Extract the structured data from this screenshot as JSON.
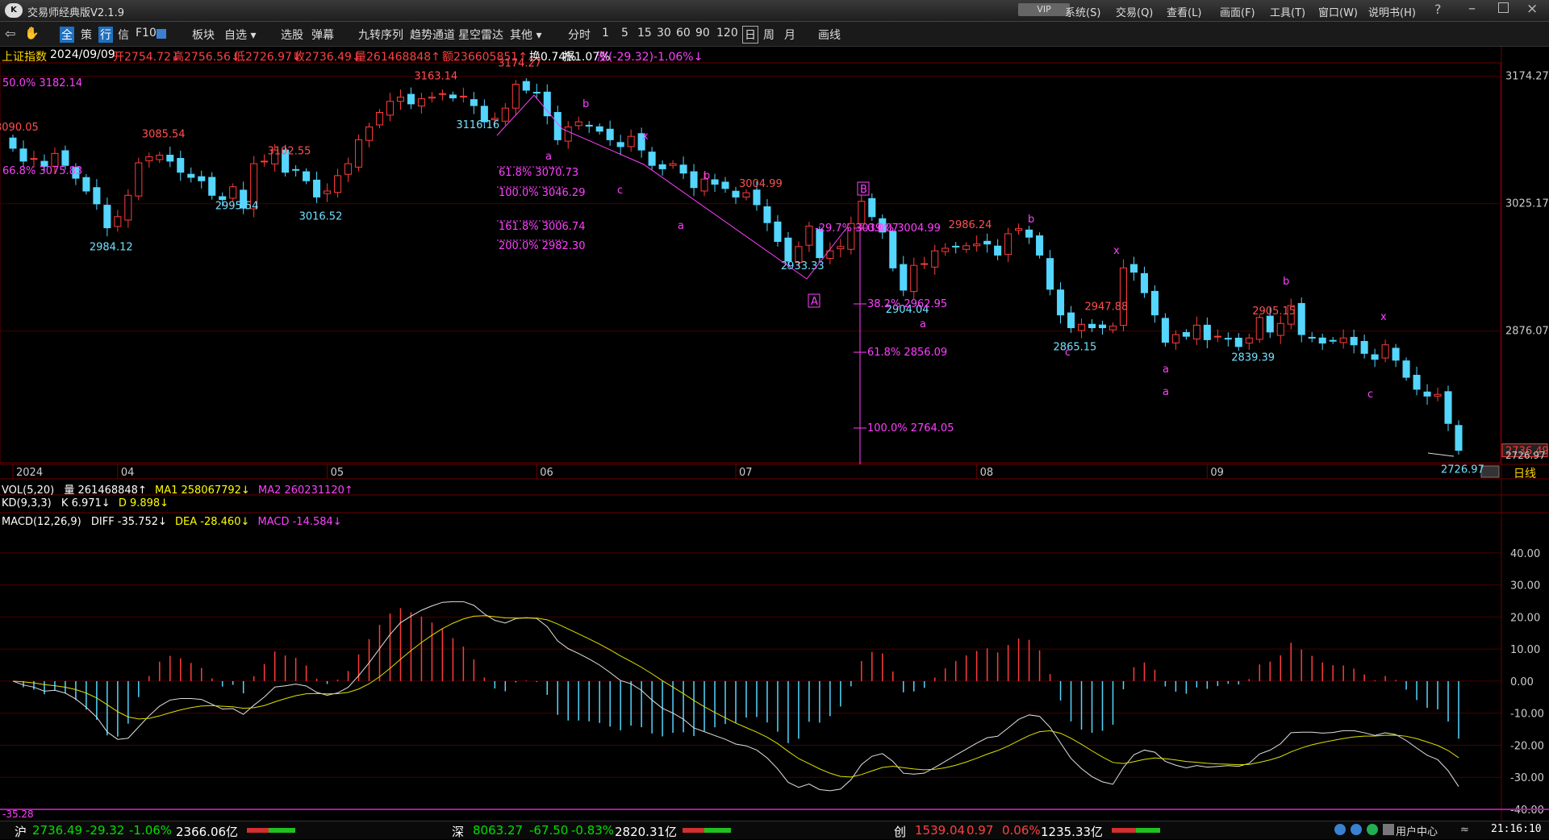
{
  "app": {
    "title": "交易师经典版V2.1.9",
    "vip": "VIP"
  },
  "menu": [
    "系统(S)",
    "交易(Q)",
    "查看(L)",
    "画面(F)",
    "工具(T)",
    "窗口(W)",
    "说明书(H)"
  ],
  "toolbar": {
    "nav_items": [
      "全",
      "策",
      "行",
      "信",
      "F10"
    ],
    "items": [
      "板块",
      "自选",
      "选股",
      "弹幕",
      "九转序列",
      "趋势通道",
      "星空雷达",
      "其他"
    ],
    "periods": [
      "分时",
      "1",
      "5",
      "15",
      "30",
      "60",
      "90",
      "120",
      "日",
      "周",
      "月"
    ],
    "draw_label": "画线"
  },
  "quote": {
    "name": "上证指数",
    "date": "2024/09/09",
    "open": "开2754.72↓",
    "high": "高2756.56↓",
    "low": "低2726.97↓",
    "close": "收2736.49↓",
    "volume": "量261468848↑",
    "amount": "额236605851↑",
    "turnover": "换0.74%",
    "amplitude": "振1.07%",
    "change": "涨(-29.32)-1.06%↓"
  },
  "colors": {
    "up": "#ff3b3b",
    "down": "#54d6ff",
    "mark": "#ff40ff",
    "dif": "#e0e0e0",
    "dea": "#e0e000"
  },
  "chart_data": [
    {
      "type": "candlestick",
      "title": "上证指数",
      "x_labels": [
        {
          "i": 0,
          "label": "2024"
        },
        {
          "i": 10,
          "label": "04"
        },
        {
          "i": 30,
          "label": "05"
        },
        {
          "i": 50,
          "label": "06"
        },
        {
          "i": 69,
          "label": "07"
        },
        {
          "i": 92,
          "label": "08"
        },
        {
          "i": 114,
          "label": "09"
        }
      ],
      "ylim": [
        2722,
        3190
      ],
      "y_ticks": [
        "3174.27",
        "3025.17",
        "2876.07"
      ],
      "last_price": "2736.49",
      "low_axis_label": "2726.97",
      "period_label": "日线",
      "fib_top": "50.0% 3182.14",
      "fib_left": "66.8% 3075.83",
      "closes": [
        3090.05,
        3075,
        3078,
        3069,
        3084,
        3070,
        3055,
        3040,
        3025,
        2997,
        3010,
        3035,
        3073,
        3080,
        3082,
        3075,
        3062,
        3056,
        3052,
        3035,
        3030,
        3045,
        3020,
        3072,
        3075,
        3088,
        3062,
        3065,
        3052,
        3033,
        3040,
        3058,
        3072,
        3100,
        3115,
        3132,
        3145,
        3150,
        3142,
        3148,
        3150,
        3154,
        3149,
        3151,
        3140,
        3121,
        3125,
        3137,
        3165,
        3158,
        3155,
        3128,
        3100,
        3115,
        3121,
        3116,
        3110,
        3100,
        3092,
        3104,
        3088,
        3070,
        3066,
        3072,
        3061,
        3044,
        3054,
        3048,
        3043,
        3033,
        3038,
        3024,
        3003,
        2981,
        2958,
        2975,
        2999,
        2962,
        2970,
        2975,
        3002,
        3028,
        3010,
        2992,
        2950,
        2924,
        2953,
        2955,
        2970,
        2973,
        2975,
        2976,
        2978,
        2978,
        2965,
        2990,
        2996,
        2986,
        2965,
        2925,
        2895,
        2880,
        2884,
        2880,
        2880,
        2882,
        2950,
        2945,
        2921,
        2895,
        2863,
        2872,
        2870,
        2883,
        2866,
        2870,
        2867,
        2858,
        2868,
        2892,
        2875,
        2885,
        2906,
        2872,
        2868,
        2862,
        2865,
        2868,
        2860,
        2850,
        2843,
        2860,
        2842,
        2822,
        2808,
        2800,
        2802,
        2768,
        2736.49
      ],
      "labels": [
        {
          "i": 0,
          "text": "3090.05",
          "pos": "high"
        },
        {
          "i": 9,
          "text": "2984.12",
          "pos": "low"
        },
        {
          "i": 14,
          "text": "3085.54",
          "pos": "high"
        },
        {
          "i": 21,
          "text": "2995.54",
          "pos": "low"
        },
        {
          "i": 26,
          "text": "3102.55",
          "pos": "high"
        },
        {
          "i": 29,
          "text": "3016.52",
          "pos": "low"
        },
        {
          "i": 40,
          "text": "3163.14",
          "pos": "high"
        },
        {
          "i": 44,
          "text": "3116.16",
          "pos": "low"
        },
        {
          "i": 48,
          "text": "3174.27",
          "pos": "high"
        },
        {
          "i": 71,
          "text": "3004.99",
          "pos": "high"
        },
        {
          "i": 75,
          "text": "2933.33",
          "pos": "low"
        },
        {
          "i": 85,
          "text": "2904.04",
          "pos": "low"
        },
        {
          "i": 91,
          "text": "2986.24",
          "pos": "high"
        },
        {
          "i": 104,
          "text": "2947.88",
          "pos": "high"
        },
        {
          "i": 101,
          "text": "2865.15",
          "pos": "low"
        },
        {
          "i": 120,
          "text": "2905.15",
          "pos": "high"
        },
        {
          "i": 118,
          "text": "2839.39",
          "pos": "low"
        },
        {
          "i": 138,
          "text": "2726.97",
          "pos": "low"
        }
      ],
      "wave_marks": [
        "a",
        "b",
        "x",
        "c",
        "b",
        "a",
        "A",
        "B",
        "a",
        "b",
        "c",
        "x",
        "a",
        "a",
        "b",
        "x",
        "c"
      ],
      "fib_levels": [
        "61.8% 3070.73",
        "100.0% 3046.29",
        "161.8% 3006.74",
        "200.0% 2982.30"
      ],
      "fib_levels_2": [
        "-29.7% 3039.07",
        "0.0% 3004.99",
        "38.2% 2962.95",
        "61.8% 2856.09",
        "100.0% 2764.05"
      ]
    },
    {
      "type": "bar",
      "title": "VOL(5,20)",
      "series": [
        {
          "name": "量",
          "values": [
            261468848
          ]
        },
        {
          "name": "MA1",
          "values": [
            258067792
          ]
        },
        {
          "name": "MA2",
          "values": [
            260231120
          ]
        }
      ],
      "labels": {
        "title": "VOL(5,20)",
        "vol": "量 261468848↑",
        "ma1": "MA1 258067792↓",
        "ma2": "MA2 260231120↑"
      }
    },
    {
      "type": "line",
      "title": "KD(9,3,3)",
      "labels": {
        "title": "KD(9,3,3)",
        "k": "K 6.971↓",
        "d": "D 9.898↓"
      }
    },
    {
      "type": "line",
      "title": "MACD(12,26,9)",
      "labels": {
        "title": "MACD(12,26,9)",
        "diff": "DIFF -35.752↓",
        "dea": "DEA -28.460↓",
        "macd": "MACD -14.584↓"
      },
      "ylim": [
        -40,
        48
      ],
      "y_ticks": [
        "40.00",
        "30.00",
        "20.00",
        "10.00",
        "0.00",
        "-10.00",
        "-20.00",
        "-30.00",
        "-40.00"
      ],
      "bottom_left": "-35.28"
    }
  ],
  "status": {
    "sh_label": "沪",
    "sh_price": "2736.49",
    "sh_change": "-29.32",
    "sh_pct": "-1.06%",
    "sh_amount": "2366.06亿",
    "sz_label": "深",
    "sz_price": "8063.27",
    "sz_change": "-67.50",
    "sz_pct": "-0.83%",
    "sz_amount": "2820.31亿",
    "cy_label": "创",
    "cy_price": "1539.04",
    "cy_change": "0.97",
    "cy_pct": "0.06%",
    "cy_amount": "1235.33亿",
    "user_center": "用户中心",
    "time": "21:16:10"
  }
}
